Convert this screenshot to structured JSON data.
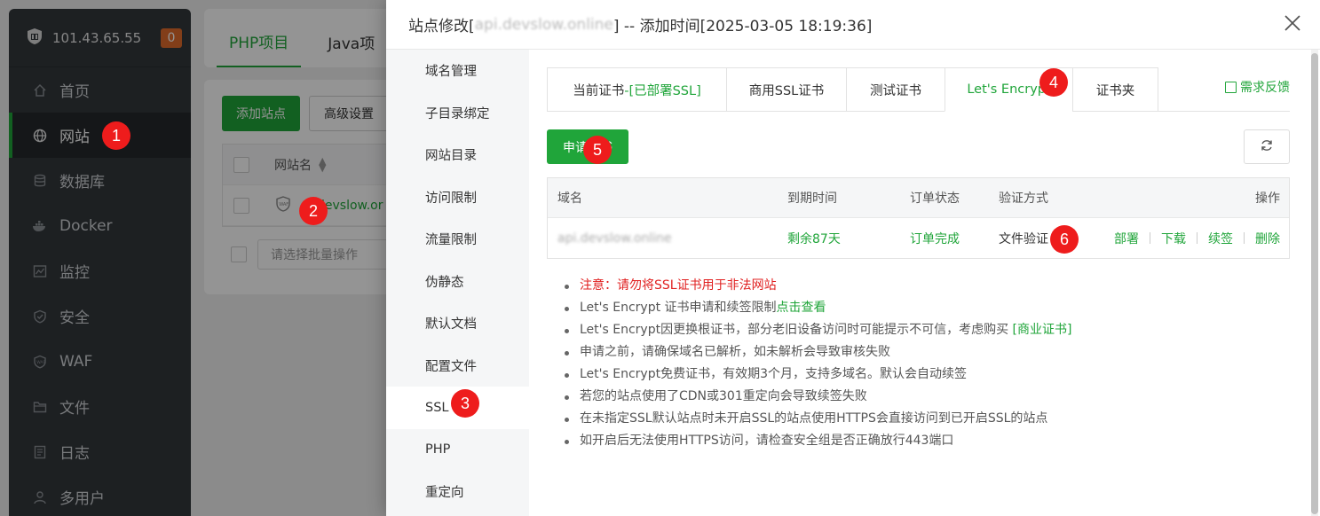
{
  "sidebar": {
    "ip": "101.43.65.55",
    "badge": "0",
    "items": [
      {
        "label": "首页",
        "icon": "home-icon"
      },
      {
        "label": "网站",
        "icon": "globe-icon"
      },
      {
        "label": "数据库",
        "icon": "database-icon"
      },
      {
        "label": "Docker",
        "icon": "docker-icon"
      },
      {
        "label": "监控",
        "icon": "monitor-icon"
      },
      {
        "label": "安全",
        "icon": "shield-icon"
      },
      {
        "label": "WAF",
        "icon": "waf-icon"
      },
      {
        "label": "文件",
        "icon": "folder-icon"
      },
      {
        "label": "日志",
        "icon": "log-icon"
      },
      {
        "label": "多用户",
        "icon": "users-icon"
      }
    ]
  },
  "background": {
    "tabs": [
      "PHP项目",
      "Java项"
    ],
    "add_site": "添加站点",
    "advanced": "高级设置",
    "col_site": "网站名",
    "site_partial": "devslow.or",
    "batch_placeholder": "请选择批量操作"
  },
  "dialog": {
    "title_prefix": "站点修改[",
    "title_domain": "api.devslow.online",
    "title_suffix": "] -- 添加时间[2025-03-05 18:19:36]",
    "menu": [
      "域名管理",
      "子目录绑定",
      "网站目录",
      "访问限制",
      "流量限制",
      "伪静态",
      "默认文档",
      "配置文件",
      "SSL",
      "PHP",
      "重定向"
    ],
    "tabs": {
      "current": "当前证书",
      "current_status": " -[已部署SSL]",
      "commercial": "商用SSL证书",
      "test": "测试证书",
      "letsencrypt": "Let's Encrypt",
      "folder": "证书夹"
    },
    "feedback": "需求反馈",
    "apply_button": "申请证书",
    "table": {
      "headers": [
        "域名",
        "到期时间",
        "订单状态",
        "验证方式",
        "操作"
      ],
      "rows": [
        {
          "domain": "api.devslow.online",
          "expiry": "剩余87天",
          "status": "订单完成",
          "verify": "文件验证",
          "ops": [
            "部署",
            "下载",
            "续签",
            "删除"
          ]
        }
      ]
    },
    "notes": {
      "n1": "注意：请勿将SSL证书用于非法网站",
      "n2_a": "Let's Encrypt 证书申请和续签限制",
      "n2_link": "点击查看",
      "n3_a": "Let's Encrypt因更换根证书，部分老旧设备访问时可能提示不可信，考虑购买 ",
      "n3_link": "[商业证书]",
      "n4": "申请之前，请确保域名已解析，如未解析会导致审核失败",
      "n5": "Let's Encrypt免费证书，有效期3个月，支持多域名。默认会自动续签",
      "n6": "若您的站点使用了CDN或301重定向会导致续签失败",
      "n7": "在未指定SSL默认站点时未开启SSL的站点使用HTTPS会直接访问到已开启SSL的站点",
      "n8": "如开启后无法使用HTTPS访问，请检查安全组是否正确放行443端口"
    }
  },
  "markers": [
    "1",
    "2",
    "3",
    "4",
    "5",
    "6"
  ],
  "colors": {
    "accent": "#20a53a",
    "marker": "#ee1c1c",
    "sidebar": "#33373c",
    "warning": "#e02020"
  }
}
